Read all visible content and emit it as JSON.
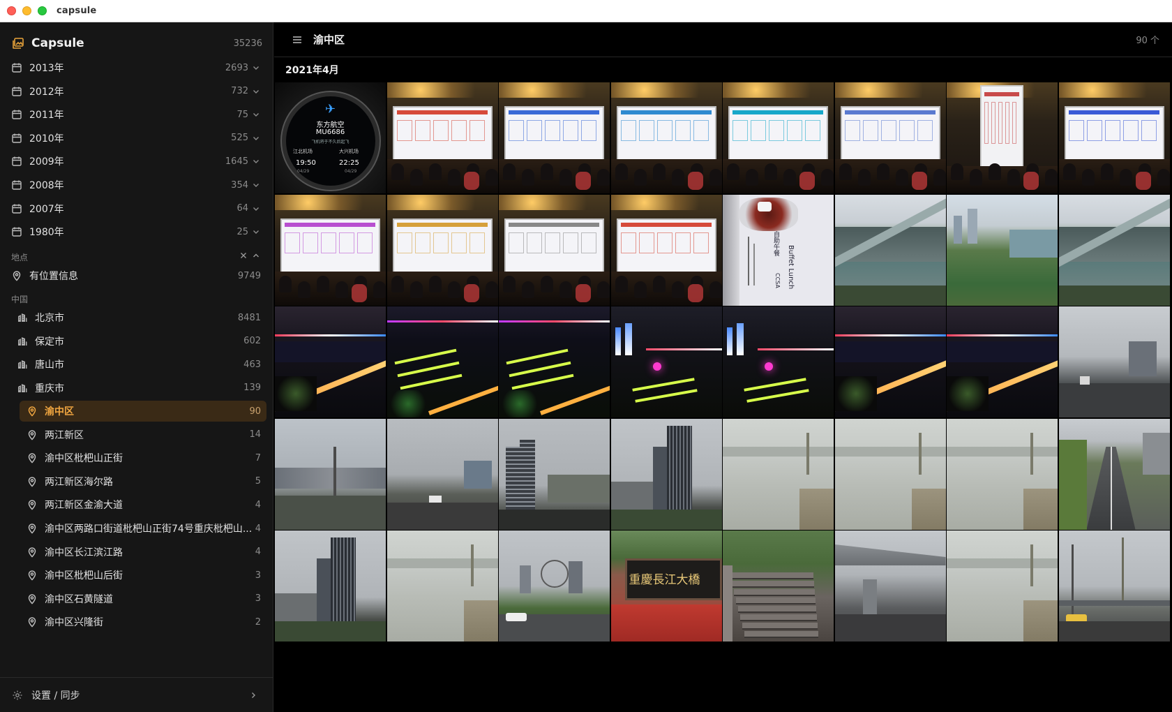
{
  "window": {
    "title": "capsule"
  },
  "brand": {
    "name": "Capsule",
    "count": "35236"
  },
  "years": [
    {
      "label": "2013年",
      "count": "2693"
    },
    {
      "label": "2012年",
      "count": "732"
    },
    {
      "label": "2011年",
      "count": "75"
    },
    {
      "label": "2010年",
      "count": "525"
    },
    {
      "label": "2009年",
      "count": "1645"
    },
    {
      "label": "2008年",
      "count": "354"
    },
    {
      "label": "2007年",
      "count": "64"
    },
    {
      "label": "1980年",
      "count": "25"
    }
  ],
  "places": {
    "section_label": "地点",
    "with_location": {
      "label": "有位置信息",
      "count": "9749"
    },
    "country_label": "中国",
    "cities": [
      {
        "label": "北京市",
        "count": "8481"
      },
      {
        "label": "保定市",
        "count": "602"
      },
      {
        "label": "唐山市",
        "count": "463"
      },
      {
        "label": "重庆市",
        "count": "139"
      }
    ],
    "districts": [
      {
        "label": "渝中区",
        "count": "90",
        "active": true
      },
      {
        "label": "两江新区",
        "count": "14"
      },
      {
        "label": "渝中区枇杷山正街",
        "count": "7"
      },
      {
        "label": "两江新区海尔路",
        "count": "5"
      },
      {
        "label": "两江新区金渝大道",
        "count": "4"
      },
      {
        "label": "渝中区两路口街道枇杷山正街74号重庆枇杷山...",
        "count": "4"
      },
      {
        "label": "渝中区长江滨江路",
        "count": "4"
      },
      {
        "label": "渝中区枇杷山后街",
        "count": "3"
      },
      {
        "label": "渝中区石黄隧道",
        "count": "3"
      },
      {
        "label": "渝中区兴隆街",
        "count": "2"
      }
    ]
  },
  "footer": {
    "settings_label": "设置 / 同步"
  },
  "main": {
    "title": "渝中区",
    "count": "90 个",
    "month_label": "2021年4月",
    "photos": [
      {
        "kind": "watch",
        "texts": [
          "东方航空",
          "MU6686",
          "飞机将于不久后起飞",
          "江北机场",
          "大兴机场",
          "19:50",
          "22:25",
          "04/29",
          "04/29"
        ]
      },
      {
        "kind": "slides",
        "accent": "#d64a3a"
      },
      {
        "kind": "slides",
        "accent": "#3a6ad6"
      },
      {
        "kind": "slides",
        "accent": "#2f8ad0"
      },
      {
        "kind": "slides",
        "accent": "#17a7c9"
      },
      {
        "kind": "slides",
        "accent": "#5a7ad0"
      },
      {
        "kind": "slides-tall",
        "accent": "#c84a4a"
      },
      {
        "kind": "slides",
        "accent": "#3a5ad6"
      },
      {
        "kind": "slides",
        "accent": "#b84fd0"
      },
      {
        "kind": "slides",
        "accent": "#d6a03a"
      },
      {
        "kind": "slides",
        "accent": "#888888"
      },
      {
        "kind": "slides",
        "accent": "#d64a3a"
      },
      {
        "kind": "receipt",
        "texts": [
          "Buffet Lunch",
          "自助午餐",
          "CCSA"
        ]
      },
      {
        "kind": "river-day"
      },
      {
        "kind": "city-green"
      },
      {
        "kind": "river-day"
      },
      {
        "kind": "night-bridge"
      },
      {
        "kind": "night-green"
      },
      {
        "kind": "night-green"
      },
      {
        "kind": "night-city"
      },
      {
        "kind": "night-city"
      },
      {
        "kind": "night-bridge"
      },
      {
        "kind": "night-bridge"
      },
      {
        "kind": "street-grey"
      },
      {
        "kind": "skyline-tower"
      },
      {
        "kind": "overcast-road"
      },
      {
        "kind": "twin-towers"
      },
      {
        "kind": "tall-building"
      },
      {
        "kind": "river-fog"
      },
      {
        "kind": "river-fog"
      },
      {
        "kind": "river-fog"
      },
      {
        "kind": "highway"
      },
      {
        "kind": "tall-building"
      },
      {
        "kind": "river-fog"
      },
      {
        "kind": "skyline-wheel"
      },
      {
        "kind": "plaque",
        "texts": [
          "重慶長江大橋"
        ]
      },
      {
        "kind": "stairs"
      },
      {
        "kind": "underbridge"
      },
      {
        "kind": "river-fog"
      },
      {
        "kind": "street-lamp"
      }
    ]
  }
}
